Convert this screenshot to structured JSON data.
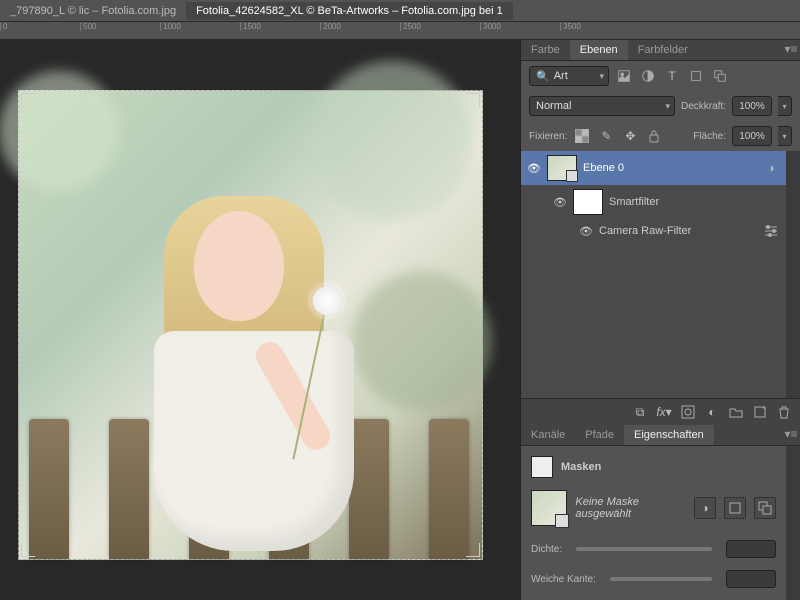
{
  "documents": {
    "tab1": "_797890_L © lic – Fotolia.com.jpg",
    "tab2_active": "Fotolia_42624582_XL © BeTa-Artworks – Fotolia.com.jpg bei 1"
  },
  "ruler": {
    "marks": [
      "0",
      "500",
      "1000",
      "1500",
      "2000",
      "2500",
      "3000",
      "3500"
    ]
  },
  "panelTabs": {
    "farbe": "Farbe",
    "ebenen": "Ebenen",
    "farbfelder": "Farbfelder"
  },
  "layers": {
    "filterLabel": "Art",
    "searchPlaceholder": "",
    "blend": "Normal",
    "opacityLabel": "Deckkraft:",
    "opacityValue": "100%",
    "lockLabel": "Fixieren:",
    "fillLabel": "Fläche:",
    "fillValue": "100%",
    "items": [
      {
        "name": "Ebene 0"
      },
      {
        "smartfilters": "Smartfilter",
        "filter": "Camera Raw-Filter"
      }
    ]
  },
  "propTabs": {
    "kanale": "Kanäle",
    "pfade": "Pfade",
    "eigenschaften": "Eigenschaften"
  },
  "properties": {
    "heading": "Masken",
    "noMask": "Keine Maske ausgewählt",
    "density": "Dichte:",
    "feather": "Weiche Kante:"
  }
}
